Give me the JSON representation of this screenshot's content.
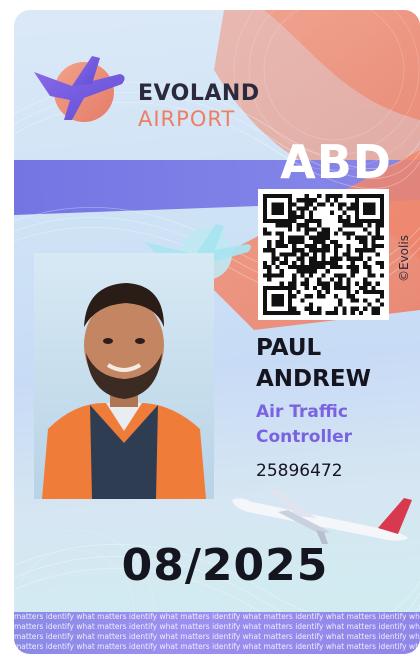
{
  "brand": {
    "line1": "EVOLAND",
    "line2": "AIRPORT"
  },
  "badge_code": "ABD",
  "holder": {
    "first_name": "PAUL",
    "last_name": "ANDREW",
    "role_line1": "Air Traffic",
    "role_line2": "Controller",
    "id_number": "25896472"
  },
  "expiry_date": "08/2025",
  "vertical_credit": "©Evolis",
  "microtext": "matters identify what matters identify what matters identify what matters identify what matters identify what matters identify",
  "colors": {
    "brand_dark": "#2a2a3c",
    "brand_coral": "#ee7e62",
    "accent_purple": "#7a62e0",
    "band_blue": "#7e7be8"
  },
  "icons": {
    "logo": "plane-logo-icon",
    "watermark": "plane-watermark-icon",
    "airliner": "airliner-icon",
    "qr": "qr-code"
  }
}
